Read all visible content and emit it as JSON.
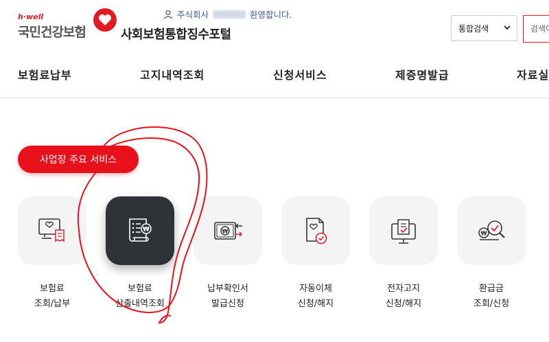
{
  "header": {
    "logo_sub": "h·well",
    "logo_main": "국민건강보험",
    "site_title": "사회보험통합징수포털",
    "welcome_prefix": "주식회사",
    "welcome_suffix": "환영합니다.",
    "search_select": "통합검색",
    "search_placeholder": "검색어"
  },
  "nav": {
    "items": [
      "보험료납부",
      "고지내역조회",
      "신청서비스",
      "제증명발급",
      "자료실"
    ]
  },
  "section": {
    "pill_label": "사업장 주요 서비스"
  },
  "services": [
    {
      "line1": "보험료",
      "line2": "조회/납부",
      "icon": "monitor-receipt-icon"
    },
    {
      "line1": "보험료",
      "line2": "산출내역조회",
      "icon": "document-won-icon"
    },
    {
      "line1": "납부확인서",
      "line2": "발급신청",
      "icon": "card-won-arrow-icon"
    },
    {
      "line1": "자동이체",
      "line2": "신청/해지",
      "icon": "document-check-icon"
    },
    {
      "line1": "전자고지",
      "line2": "신청/해지",
      "icon": "monitor-document-icon"
    },
    {
      "line1": "환급금",
      "line2": "조회/신청",
      "icon": "coin-search-check-icon"
    }
  ],
  "colors": {
    "brand_red": "#e11a24",
    "active_tile": "#2f3237",
    "tile_bg": "#f4f4f4"
  }
}
